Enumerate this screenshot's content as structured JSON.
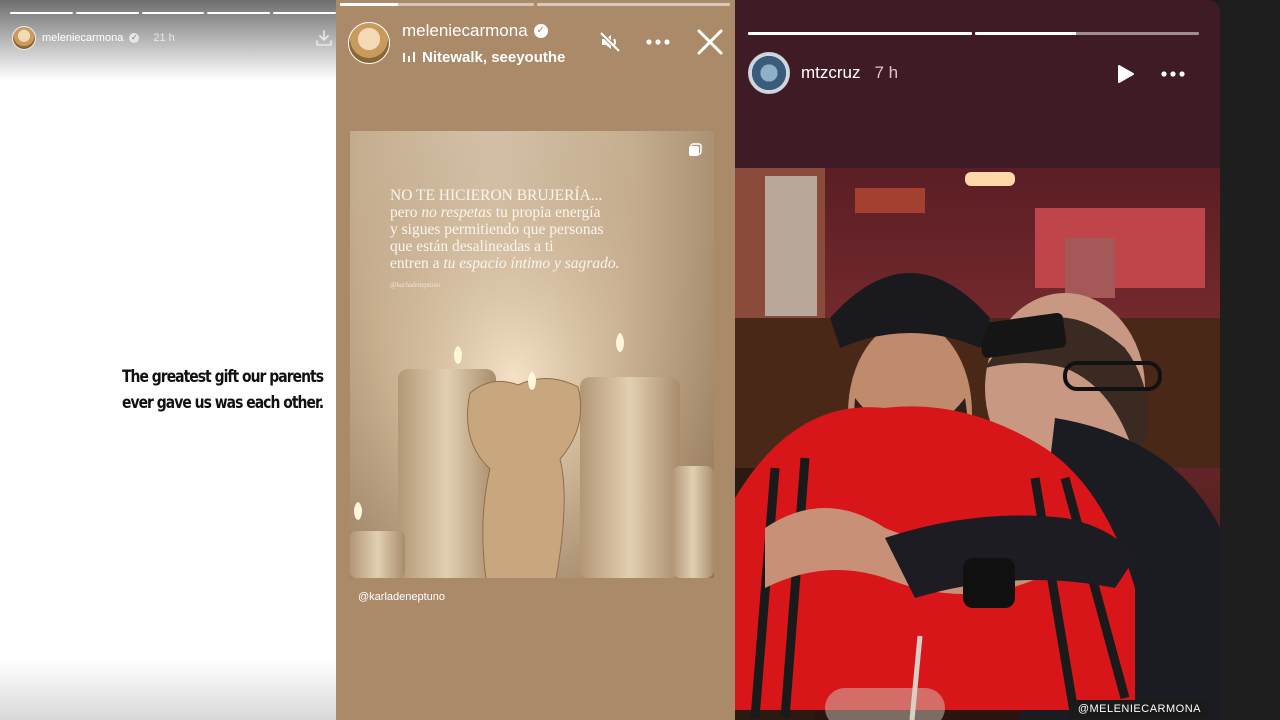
{
  "left_story": {
    "username": "meleniecarmona",
    "time": "21 h",
    "quote_line1": "The greatest gift our parents",
    "quote_line2": "ever gave us was each other."
  },
  "center_story": {
    "username": "meleniecarmona",
    "music": "Nitewalk, seeyouthe",
    "post": {
      "line1": "NO TE HICIERON BRUJERÍA...",
      "line2_a": "pero ",
      "line2_b": "no respetas",
      "line2_c": " tu propia energía",
      "line3": "y sigues permitiendo que personas",
      "line4": "que están desalineadas a ti",
      "line5_a": "entren a ",
      "line5_b": "tu espacio íntimo y sagrado.",
      "handle": "@karladeneptuno"
    },
    "mention": "@karladeneptuno"
  },
  "right_story": {
    "username": "mtzcruz",
    "time": "7 h",
    "photo_tag": "@MELENIECARMONA"
  },
  "icons": {
    "download": "download-icon",
    "mute": "speaker-muted-icon",
    "more": "more-horizontal-icon",
    "close": "close-icon",
    "play": "play-icon",
    "verified": "verified-badge-icon",
    "music": "music-bars-icon"
  },
  "colors": {
    "center_bg": "#ab8a6a",
    "right_bg": "#3f1b26",
    "jacket_red": "#d8161a"
  }
}
